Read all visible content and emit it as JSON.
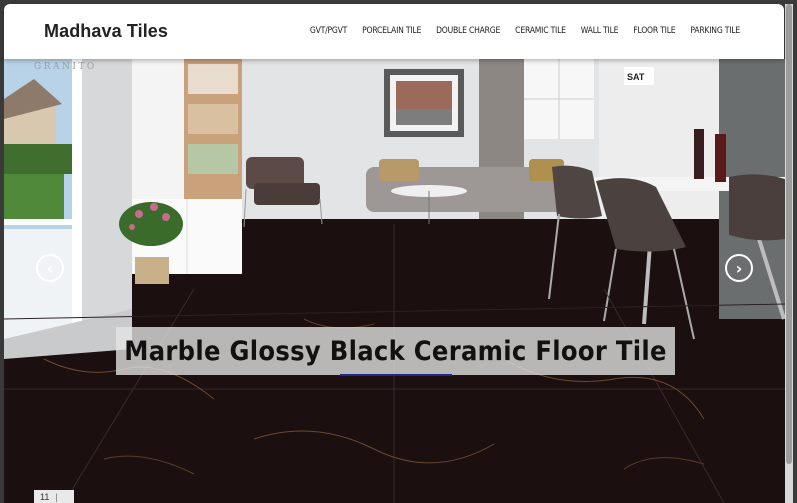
{
  "header": {
    "brand": "Madhava Tiles",
    "nav": [
      {
        "label": "GVT/PGVT"
      },
      {
        "label": "PORCELAIN TILE"
      },
      {
        "label": "DOUBLE CHARGE"
      },
      {
        "label": "CERAMIC TILE"
      },
      {
        "label": "WALL TILE"
      },
      {
        "label": "FLOOR TILE"
      },
      {
        "label": "PARKING TILE"
      }
    ]
  },
  "hero": {
    "watermark": "GRANITO",
    "caption": "Marble Glossy Black Ceramic Floor Tile",
    "counter": "11",
    "prev_icon": "chevron-left-icon",
    "next_icon": "chevron-right-icon",
    "sign": "SAT"
  },
  "colors": {
    "header_bg": "#ffffff",
    "floor": "#1b0f10",
    "wall": "#e3e4e6",
    "caption_bg": "#e6e6e6",
    "underline": "#1c2a8c"
  }
}
